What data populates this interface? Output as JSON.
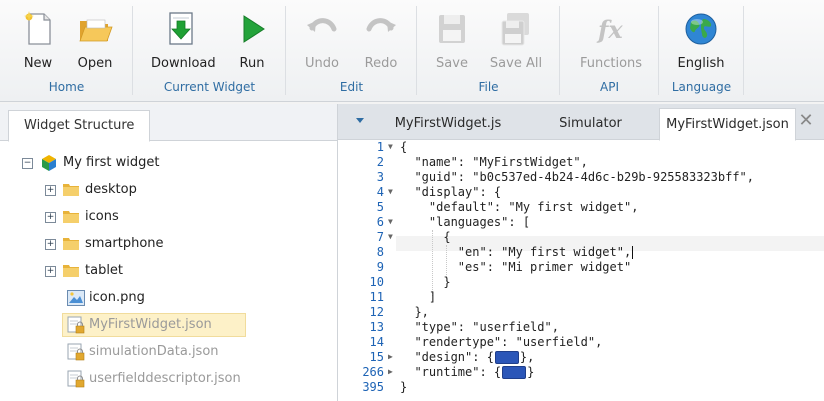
{
  "ribbon": {
    "groups": [
      {
        "label": "Home",
        "buttons": [
          {
            "label": "New",
            "icon": "new-document-icon"
          },
          {
            "label": "Open",
            "icon": "open-folder-icon"
          }
        ]
      },
      {
        "label": "Current Widget",
        "buttons": [
          {
            "label": "Download",
            "icon": "download-icon"
          },
          {
            "label": "Run",
            "icon": "run-play-icon"
          }
        ]
      },
      {
        "label": "Edit",
        "buttons": [
          {
            "label": "Undo",
            "icon": "undo-icon"
          },
          {
            "label": "Redo",
            "icon": "redo-icon"
          }
        ]
      },
      {
        "label": "File",
        "buttons": [
          {
            "label": "Save",
            "icon": "save-icon"
          },
          {
            "label": "Save All",
            "icon": "save-all-icon"
          }
        ]
      },
      {
        "label": "API",
        "buttons": [
          {
            "label": "Functions",
            "icon": "functions-fx-icon"
          }
        ]
      },
      {
        "label": "Language",
        "buttons": [
          {
            "label": "English",
            "icon": "globe-icon"
          }
        ]
      }
    ]
  },
  "left_panel": {
    "tab": "Widget Structure",
    "root": "My first widget",
    "folders": [
      "desktop",
      "icons",
      "smartphone",
      "tablet"
    ],
    "files": [
      "icon.png",
      "MyFirstWidget.json",
      "simulationData.json",
      "userfielddescriptor.json"
    ]
  },
  "editor": {
    "tabs": [
      "MyFirstWidget.js",
      "Simulator",
      "MyFirstWidget.json"
    ],
    "line_numbers": [
      "1",
      "2",
      "3",
      "4",
      "5",
      "6",
      "7",
      "8",
      "9",
      "10",
      "11",
      "12",
      "13",
      "14",
      "15",
      "266",
      "395"
    ],
    "lines": [
      "{",
      "  \"name\": \"MyFirstWidget\",",
      "  \"guid\": \"b0c537ed-4b24-4d6c-b29b-925583323bff\",",
      "  \"display\": {",
      "    \"default\": \"My first widget\",",
      "    \"languages\": [",
      "      {",
      "        \"en\": \"My first widget\",",
      "        \"es\": \"Mi primer widget\"",
      "      }",
      "    ]",
      "  },",
      "  \"type\": \"userfield\",",
      "  \"rendertype\": \"userfield\",",
      "  \"design\": {",
      "  \"runtime\": {",
      "}"
    ]
  },
  "colors": {
    "accent": "#2f6da3",
    "selection": "#fdf1c8",
    "line_number": "#1d63b5"
  }
}
